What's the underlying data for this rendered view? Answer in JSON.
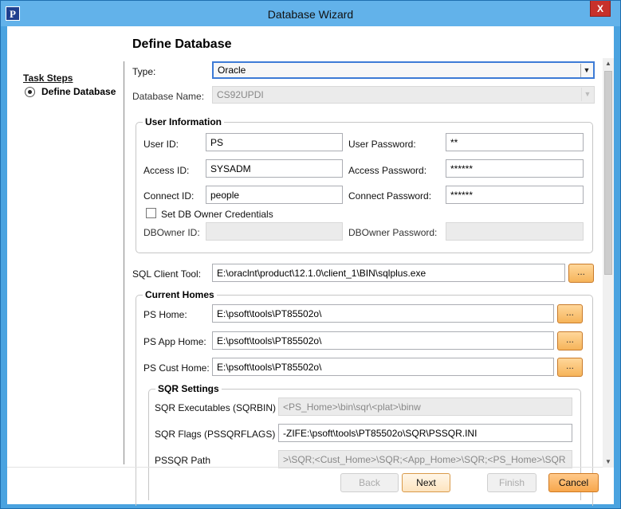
{
  "window": {
    "title": "Database Wizard",
    "icon_letter": "P",
    "close_glyph": "X"
  },
  "sidebar": {
    "heading": "Task Steps",
    "steps": [
      {
        "label": "Define Database"
      }
    ]
  },
  "page": {
    "heading": "Define Database"
  },
  "form": {
    "type_label": "Type:",
    "type_value": "Oracle",
    "dbname_label": "Database Name:",
    "dbname_value": "CS92UPDI",
    "user_info": {
      "title": "User Information",
      "user_id_label": "User ID:",
      "user_id": "PS",
      "user_password_label": "User Password:",
      "user_password": "**",
      "access_id_label": "Access ID:",
      "access_id": "SYSADM",
      "access_password_label": "Access Password:",
      "access_password": "******",
      "connect_id_label": "Connect ID:",
      "connect_id": "people",
      "connect_password_label": "Connect Password:",
      "connect_password": "******",
      "owner_checkbox_label": "Set DB Owner Credentials",
      "dbowner_id_label": "DBOwner ID:",
      "dbowner_id": "",
      "dbowner_password_label": "DBOwner Password:",
      "dbowner_password": ""
    },
    "sql_client_label": "SQL Client Tool:",
    "sql_client_value": "E:\\oraclnt\\product\\12.1.0\\client_1\\BIN\\sqlplus.exe",
    "browse_label": "...",
    "current_homes": {
      "title": "Current Homes",
      "ps_home_label": "PS Home:",
      "ps_home": "E:\\psoft\\tools\\PT85502o\\",
      "ps_app_home_label": "PS App Home:",
      "ps_app_home": "E:\\psoft\\tools\\PT85502o\\",
      "ps_cust_home_label": "PS Cust Home:",
      "ps_cust_home": "E:\\psoft\\tools\\PT85502o\\"
    },
    "sqr": {
      "title": "SQR Settings",
      "executables_label": "SQR Executables (SQRBIN)",
      "executables": "<PS_Home>\\bin\\sqr\\<plat>\\binw",
      "flags_label": "SQR Flags (PSSQRFLAGS)",
      "flags": "-ZIFE:\\psoft\\tools\\PT85502o\\SQR\\PSSQR.INI",
      "path_label": "PSSQR Path",
      "path": ">\\SQR;<Cust_Home>\\SQR;<App_Home>\\SQR;<PS_Home>\\SQR"
    }
  },
  "buttons": {
    "back": "Back",
    "next": "Next",
    "finish": "Finish",
    "cancel": "Cancel"
  }
}
